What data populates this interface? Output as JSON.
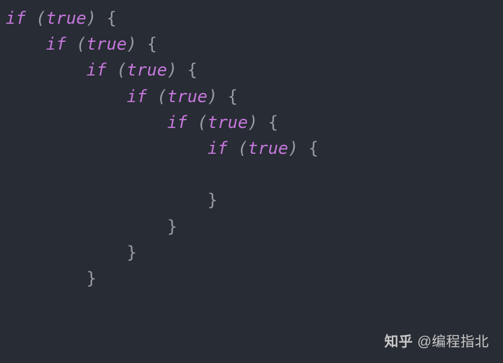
{
  "code": {
    "keyword": "if",
    "paren_open": "(",
    "paren_close": ")",
    "literal": "true",
    "brace_open": "{",
    "brace_close": "}",
    "indent_unit": "    ",
    "lines": [
      {
        "indent": 0,
        "type": "open"
      },
      {
        "indent": 1,
        "type": "open"
      },
      {
        "indent": 2,
        "type": "open"
      },
      {
        "indent": 3,
        "type": "open"
      },
      {
        "indent": 4,
        "type": "open"
      },
      {
        "indent": 5,
        "type": "open"
      },
      {
        "indent": 5,
        "type": "blank"
      },
      {
        "indent": 5,
        "type": "close"
      },
      {
        "indent": 4,
        "type": "close"
      },
      {
        "indent": 3,
        "type": "close"
      },
      {
        "indent": 2,
        "type": "close"
      }
    ]
  },
  "watermark": {
    "logo": "知乎",
    "at": "@",
    "author": "编程指北"
  },
  "colors": {
    "background": "#282c34",
    "keyword": "#c678dd",
    "punctuation": "#999ca3",
    "watermark": "#c8c8c8"
  }
}
